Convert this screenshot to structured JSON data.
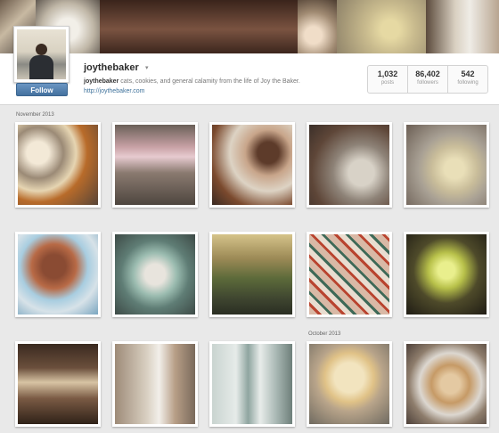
{
  "profile": {
    "username": "joythebaker",
    "caret": "▾",
    "bio_name": "joythebaker",
    "bio_text": " cats, cookies, and general calamity from the life of Joy the Baker.",
    "website": "http://joythebaker.com",
    "follow_label": "Follow"
  },
  "stats": [
    {
      "value": "1,032",
      "label": "posts"
    },
    {
      "value": "86,402",
      "label": "followers"
    },
    {
      "value": "542",
      "label": "following"
    }
  ],
  "sections": {
    "november": "November 2013",
    "october": "October 2013"
  },
  "banner_tiles": [
    {
      "name": "banner-tile-camera",
      "bg": "linear-gradient(135deg,#6b5a4a,#c8b9a2 40%,#3b3330)",
      "w": 40
    },
    {
      "name": "banner-tile-plates",
      "bg": "radial-gradient(circle at 50% 50%,#f2efe8 25%,#bfb6a6 60%,#5f574f)",
      "w": 72
    },
    {
      "name": "banner-tile-cafe",
      "bg": "linear-gradient(180deg,#3a241b,#7a5341 50%,#2e1c15)",
      "w": 222
    },
    {
      "name": "banner-tile-eggs",
      "bg": "radial-gradient(circle at 40% 60%,#f0ddc8 20%,#a08a72 55%,#4c3c30)",
      "w": 44
    },
    {
      "name": "banner-tile-cookies",
      "bg": "radial-gradient(circle at 60% 50%,#e6d9a3 15%,#c9bb8e 40%,#8d8168)",
      "w": 100
    },
    {
      "name": "banner-tile-baker",
      "bg": "linear-gradient(90deg,#5b4a3c,#d9d0c1 40%,#efece6 60%,#b8a590)",
      "w": 82
    }
  ],
  "photos": [
    {
      "name": "photo-baking-ingredients",
      "bg": "radial-gradient(circle at 25% 35%,#f3e9d7 14%,#9b8a76 32%,#e6d5b2 48%,#b86b2a 62%,#584538)"
    },
    {
      "name": "photo-pink-cups",
      "bg": "linear-gradient(180deg,#6a6058 0%,#c9a2a6 28%,#e7cbd0 40%,#8a7a70 60%,#4e463f)"
    },
    {
      "name": "photo-tea-coffee",
      "bg": "radial-gradient(circle at 70% 35%,#5d3b2a 14%,#c8a58a 30%,#ddd3c4 50%,#7b4a2e 75%,#3a2a22)"
    },
    {
      "name": "photo-cheese-grater",
      "bg": "radial-gradient(circle at 65% 60%,#d8d2c7 18%,#8e8378 40%,#5e4638 70%,#3b2f29)"
    },
    {
      "name": "photo-cookie-tray",
      "bg": "radial-gradient(circle at 60% 55%,#e9dfb8 15%,#c9bd9a 35%,#a8a094 55%,#6b5e54)"
    },
    {
      "name": "photo-bread-slices",
      "bg": "radial-gradient(circle at 45% 40%,#8a4b33 18%,#b86a46 34%,#a8cde0 52%,#d7e2e8 70%,#7aa6c0)"
    },
    {
      "name": "photo-cups-stacked",
      "bg": "radial-gradient(circle at 50% 50%,#e8e4dd 18%,#9bbcb0 38%,#5f7d75 60%,#3d4a46)"
    },
    {
      "name": "photo-park-trees",
      "bg": "linear-gradient(180deg,#d5c38a 0%,#9c8a56 30%,#5c6a3a 55%,#3f4630 80%,#2a2e22)"
    },
    {
      "name": "photo-patterned-floor",
      "bg": "repeating-linear-gradient(45deg,#d9b9a6 0 7px,#b9442f 7px 10px,#e9ddd0 10px 16px,#3f6a58 16px 19px)"
    },
    {
      "name": "photo-glass-drink",
      "bg": "radial-gradient(circle at 50% 45%,#e9ef8d 14%,#b8c14a 30%,#4e4a2a 55%,#1f1c14)"
    },
    {
      "name": "photo-kitchen-shelves",
      "bg": "linear-gradient(180deg,#3a2a20 0%,#6b4f3c 30%,#d8c4a4 48%,#7a5a44 68%,#2f2218)"
    },
    {
      "name": "photo-woman-cake",
      "bg": "linear-gradient(90deg,#9e8b78,#d9d0c2 40%,#f2efea 55%,#b79e86 75%,#7a6a5c)"
    },
    {
      "name": "photo-laundromat",
      "bg": "linear-gradient(90deg,#c9d4d0 0%,#e6ebe9 30%,#8fa5a0 45%,#e8ecea 60%,#a9b8b4 80%,#6e7f7a)"
    },
    {
      "name": "photo-pie",
      "bg": "radial-gradient(circle at 50% 42%,#f2e4bf 24%,#e0c287 40%,#b8a48a 55%,#6f6a60)"
    },
    {
      "name": "photo-pastries-platter",
      "bg": "radial-gradient(circle at 55% 50%,#e4c9a2 16%,#c69a66 32%,#dcd7d0 52%,#8e7d6c 70%,#4d4039)"
    }
  ]
}
